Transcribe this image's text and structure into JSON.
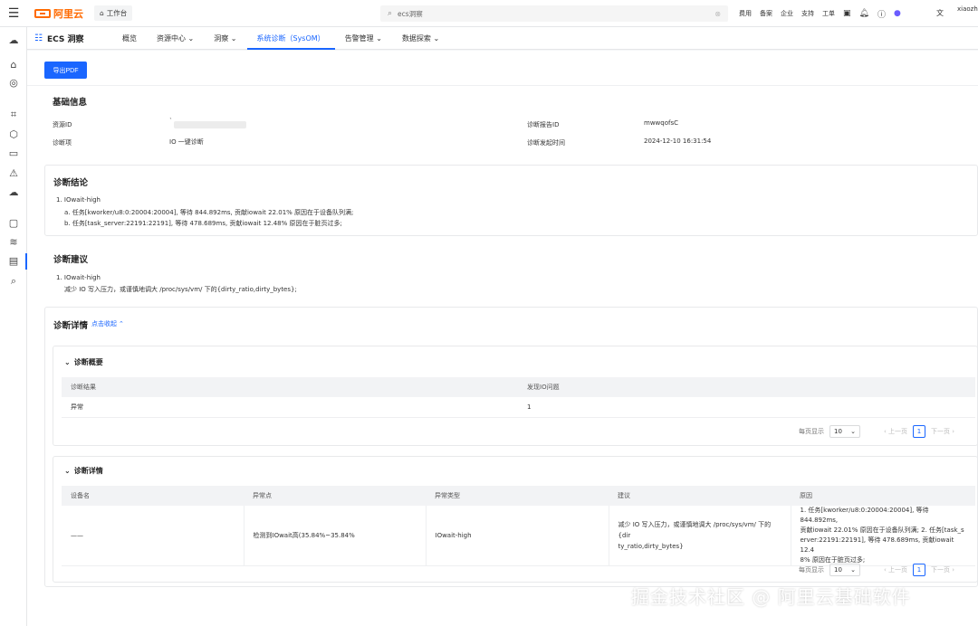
{
  "topbar": {
    "logo_text": "阿里云",
    "workbench": "工作台",
    "search_placeholder": "ecs洞察",
    "nav": [
      "费用",
      "备案",
      "企业",
      "支持",
      "工单"
    ],
    "user": "xiaozh"
  },
  "subnav": {
    "product": "ECS 洞察",
    "tabs": [
      "概览",
      "资源中心",
      "洞察",
      "系统诊断（SysOM）",
      "告警管理",
      "数据探索"
    ],
    "active_tab": "系统诊断（SysOM）"
  },
  "toolbar": {
    "export_pdf": "导出PDF"
  },
  "basic_info": {
    "title": "基础信息",
    "resource_id_label": "资源ID",
    "resource_id_value": "`",
    "report_id_label": "诊断报告ID",
    "report_id_value": "mwwqofsC",
    "item_label": "诊断项",
    "item_value": "IO 一键诊断",
    "time_label": "诊断发起时间",
    "time_value": "2024-12-10 16:31:54"
  },
  "conclusion": {
    "title": "诊断结论",
    "item1": "1. IOwait-high",
    "item1a": "a. 任务[kworker/u8:0:20004:20004], 等待 844.892ms, 贡献iowait 22.01% 原因在于设备队列满;",
    "item1b": "b. 任务[task_server:22191:22191], 等待 478.689ms, 贡献iowait 12.48% 原因在于脏页过多;"
  },
  "suggestion": {
    "title": "诊断建议",
    "item1": "1. IOwait-high",
    "item1_text": "减少 IO 写入压力，或谨慎地调大 /proc/sys/vm/ 下的{dirty_ratio,dirty_bytes};"
  },
  "details": {
    "title": "诊断详情",
    "toggle": "点击收起",
    "overview": {
      "title": "诊断概要",
      "headers": [
        "诊断结果",
        "发现IO问题"
      ],
      "row": [
        "异常",
        "1"
      ]
    },
    "detail": {
      "title": "诊断详情",
      "headers": [
        "设备名",
        "异常点",
        "异常类型",
        "建议",
        "原因"
      ],
      "row": {
        "device": "——",
        "point": "检测到IOwait高(35.84%~35.84%",
        "type": "IOwait-high",
        "advice_1": "减少 IO 写入压力，或谨慎地调大 /proc/sys/vm/ 下的{dir",
        "advice_2": "ty_ratio,dirty_bytes}",
        "reason_1": "1. 任务[kworker/u8:0:20004:20004], 等待 844.892ms,",
        "reason_2": "贡献iowait 22.01% 原因在于设备队列满; 2. 任务[task_s",
        "reason_3": "erver:22191:22191], 等待 478.689ms, 贡献iowait 12.4",
        "reason_4": "8% 原因在于脏页过多;"
      }
    },
    "pager": {
      "per_page_label": "每页显示",
      "per_page": "10",
      "prev": "上一页",
      "page": "1",
      "next": "下一页"
    }
  },
  "watermark": "掘金技术社区 @ 阿里云基础软件",
  "colors": {
    "primary": "#1a66ff",
    "brand": "#ff6a00"
  }
}
